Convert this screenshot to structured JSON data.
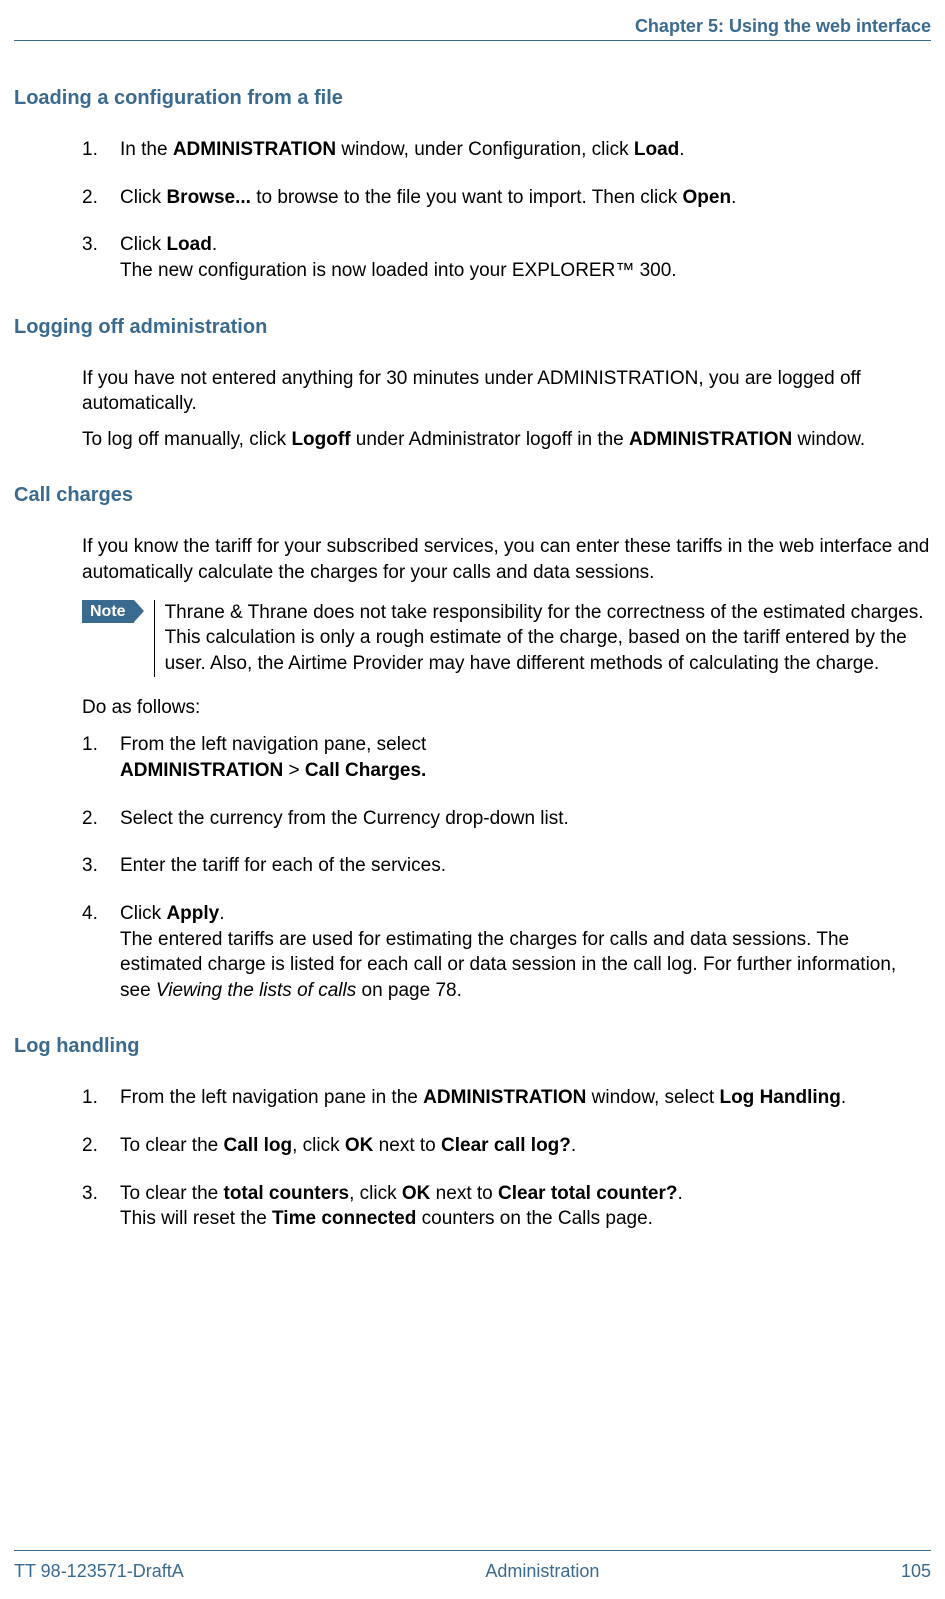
{
  "header": {
    "chapter": "Chapter 5: Using the web interface"
  },
  "sections": {
    "loading": {
      "title": "Loading a configuration from a file",
      "items": [
        {
          "n": "1.",
          "pre": "In the ",
          "b1": "ADMINISTRATION",
          "mid": " window, under Configuration, click ",
          "b2": "Load",
          "post": "."
        },
        {
          "n": "2.",
          "pre": "Click ",
          "b1": "Browse...",
          "mid": " to browse to the file you want to import. Then click ",
          "b2": "Open",
          "post": "."
        },
        {
          "n": "3.",
          "pre": "Click ",
          "b1": "Load",
          "post": ".",
          "cont": "The new configuration is now loaded into your EXPLORER™ 300."
        }
      ]
    },
    "logoff": {
      "title": "Logging off administration",
      "p1": "If you have not entered anything for 30 minutes under ADMINISTRATION, you are logged off automatically.",
      "p2_pre": "To log off manually, click ",
      "p2_b1": "Logoff",
      "p2_mid": " under Administrator logoff in the ",
      "p2_b2": "ADMINISTRATION",
      "p2_post": " window."
    },
    "charges": {
      "title": "Call charges",
      "intro": "If you know the tariff for your subscribed services, you can enter these tariffs in the web interface and automatically calculate the charges for your calls and data sessions.",
      "note_label": "Note",
      "note_text": "Thrane & Thrane does not take responsibility for the correctness of the estimated charges. This calculation is only a rough estimate of the charge, based on the tariff entered by the user. Also, the Airtime Provider may have different methods of calculating the charge.",
      "do": "Do as follows:",
      "items": [
        {
          "n": "1.",
          "l1": "From the left navigation pane, select",
          "b1": "ADMINISTRATION",
          "sep": " > ",
          "b2": "Call Charges."
        },
        {
          "n": "2.",
          "text": "Select the currency from the Currency drop-down list."
        },
        {
          "n": "3.",
          "text": "Enter the tariff for each of the services."
        },
        {
          "n": "4.",
          "pre": "Click ",
          "b1": "Apply",
          "post": ".",
          "cont_pre": "The entered tariffs are used for estimating the charges for calls and data sessions. The estimated charge is listed for each call or data session in the call log. For further information, see ",
          "cont_i": "Viewing the lists of calls",
          "cont_post": " on page 78."
        }
      ]
    },
    "loghandling": {
      "title": "Log handling",
      "items": [
        {
          "n": "1.",
          "pre": "From the left navigation pane in the ",
          "b1": "ADMINISTRATION",
          "mid": " window, select ",
          "b2": "Log Handling",
          "post": "."
        },
        {
          "n": "2.",
          "pre": "To clear the ",
          "b1": "Call log",
          "mid": ", click ",
          "b2": "OK",
          "mid2": " next to ",
          "b3": "Clear call log?",
          "post": "."
        },
        {
          "n": "3.",
          "pre": "To clear the ",
          "b1": "total counters",
          "mid": ", click ",
          "b2": "OK",
          "mid2": " next to ",
          "b3": "Clear total counter?",
          "post": ".",
          "cont_pre": "This will reset the ",
          "cont_b": "Time connected",
          "cont_post": " counters on the Calls page."
        }
      ]
    }
  },
  "footer": {
    "left": "TT 98-123571-DraftA",
    "center": "Administration",
    "right": "105"
  }
}
